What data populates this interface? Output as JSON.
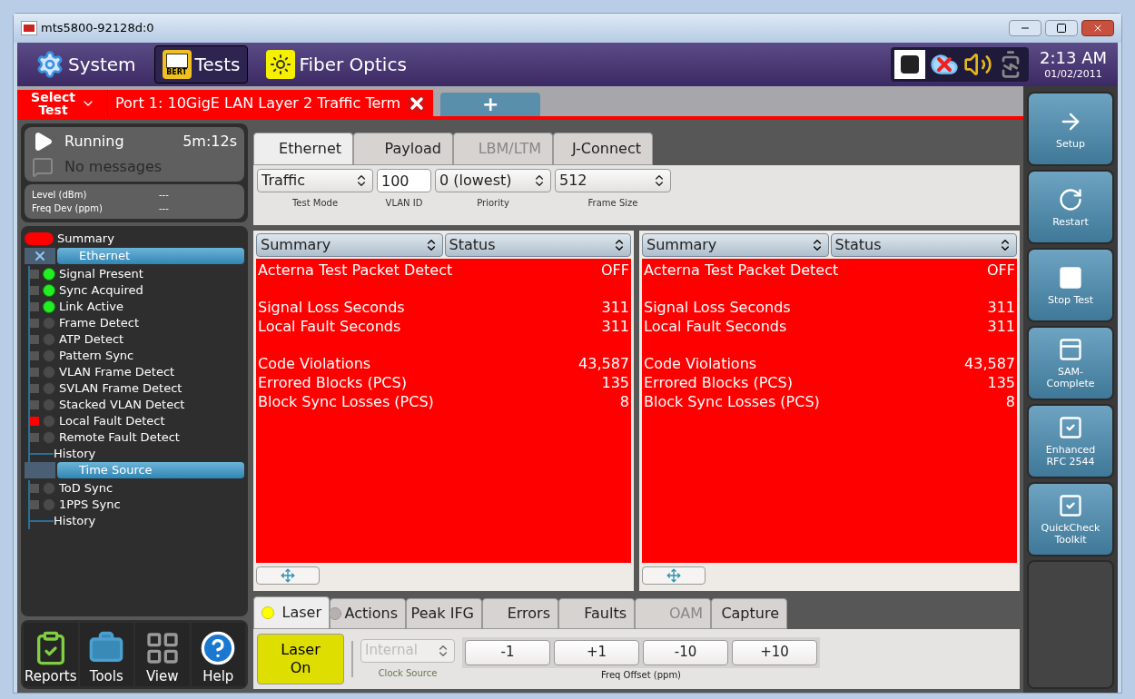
{
  "window": {
    "title": "mts5800-92128d:0"
  },
  "topbar": {
    "menus": [
      {
        "kind": "system",
        "label": "System",
        "selected": false
      },
      {
        "kind": "tests",
        "label": "Tests",
        "badge": "BERT",
        "selected": true
      },
      {
        "kind": "fiber",
        "label": "Fiber Optics",
        "selected": false
      }
    ],
    "time": "2:13 AM",
    "date": "01/02/2011"
  },
  "test_tabs": {
    "select_label": "Select Test",
    "port_tab": "Port 1: 10GigE LAN Layer 2 Traffic Term",
    "add_label": "+"
  },
  "status": {
    "state": "Running",
    "elapsed": "5m:12s",
    "messages": "No messages"
  },
  "readings": [
    {
      "label": "Level (dBm)",
      "value": "---"
    },
    {
      "label": "Freq Dev (ppm)",
      "value": "---"
    }
  ],
  "tree": {
    "summary": "Summary",
    "summary_alarm": true,
    "groups": [
      {
        "title": "Ethernet",
        "closable": true,
        "items": [
          {
            "label": "Signal Present",
            "lit": true,
            "alarm": false
          },
          {
            "label": "Sync Acquired",
            "lit": true,
            "alarm": false
          },
          {
            "label": "Link Active",
            "lit": true,
            "alarm": false
          },
          {
            "label": "Frame Detect",
            "lit": false,
            "alarm": false
          },
          {
            "label": "ATP Detect",
            "lit": false,
            "alarm": false
          },
          {
            "label": "Pattern Sync",
            "lit": false,
            "alarm": false
          },
          {
            "label": "VLAN Frame Detect",
            "lit": false,
            "alarm": false
          },
          {
            "label": "SVLAN Frame Detect",
            "lit": false,
            "alarm": false
          },
          {
            "label": "Stacked VLAN Detect",
            "lit": false,
            "alarm": false
          },
          {
            "label": "Local Fault Detect",
            "lit": false,
            "alarm": true
          },
          {
            "label": "Remote Fault Detect",
            "lit": false,
            "alarm": false
          }
        ],
        "history": "History"
      },
      {
        "title": "Time Source",
        "closable": false,
        "items": [
          {
            "label": "ToD Sync",
            "lit": false,
            "alarm": false
          },
          {
            "label": "1PPS Sync",
            "lit": false,
            "alarm": false
          }
        ],
        "history": "History"
      }
    ]
  },
  "tools": [
    {
      "kind": "reports",
      "label": "Reports"
    },
    {
      "kind": "tools",
      "label": "Tools"
    },
    {
      "kind": "view",
      "label": "View"
    },
    {
      "kind": "help",
      "label": "Help"
    }
  ],
  "config_tabs": [
    {
      "label": "Ethernet",
      "selected": true,
      "disabled": false
    },
    {
      "label": "Payload",
      "selected": false,
      "disabled": false
    },
    {
      "label": "LBM/LTM",
      "selected": false,
      "disabled": true
    },
    {
      "label": "J-Connect",
      "selected": false,
      "disabled": false
    }
  ],
  "config_fields": [
    {
      "kind": "select",
      "value": "Traffic",
      "label": "Test Mode"
    },
    {
      "kind": "input",
      "value": "100",
      "label": "VLAN ID"
    },
    {
      "kind": "select",
      "value": "0 (lowest)",
      "label": "Priority"
    },
    {
      "kind": "select",
      "value": "512",
      "label": "Frame Size"
    }
  ],
  "panes": [
    {
      "columns": [
        "Summary",
        "Status"
      ],
      "groups": [
        [
          {
            "label": "Acterna Test Packet Detect",
            "value": "OFF"
          }
        ],
        [
          {
            "label": "Signal Loss Seconds",
            "value": "311"
          },
          {
            "label": "Local Fault Seconds",
            "value": "311"
          }
        ],
        [
          {
            "label": "Code Violations",
            "value": "43,587"
          },
          {
            "label": "Errored Blocks (PCS)",
            "value": "135"
          },
          {
            "label": "Block Sync Losses (PCS)",
            "value": "8"
          }
        ]
      ]
    },
    {
      "columns": [
        "Summary",
        "Status"
      ],
      "groups": [
        [
          {
            "label": "Acterna Test Packet Detect",
            "value": "OFF"
          }
        ],
        [
          {
            "label": "Signal Loss Seconds",
            "value": "311"
          },
          {
            "label": "Local Fault Seconds",
            "value": "311"
          }
        ],
        [
          {
            "label": "Code Violations",
            "value": "43,587"
          },
          {
            "label": "Errored Blocks (PCS)",
            "value": "135"
          },
          {
            "label": "Block Sync Losses (PCS)",
            "value": "8"
          }
        ]
      ]
    }
  ],
  "action_tabs": [
    {
      "label": "Laser",
      "selected": true,
      "disabled": false,
      "led_lit": true
    },
    {
      "label": "Actions",
      "selected": false,
      "disabled": false,
      "led_lit": false
    },
    {
      "label": "Peak IFG",
      "selected": false,
      "disabled": false
    },
    {
      "label": "Errors",
      "selected": false,
      "disabled": false
    },
    {
      "label": "Faults",
      "selected": false,
      "disabled": false
    },
    {
      "label": "OAM",
      "selected": false,
      "disabled": true
    },
    {
      "label": "Capture",
      "selected": false,
      "disabled": false
    }
  ],
  "laser_button": {
    "label": "Laser On",
    "on": true
  },
  "clock_source": {
    "value": "Internal",
    "label": "Clock Source",
    "disabled": true
  },
  "freq_offset": {
    "buttons": [
      "-1",
      "+1",
      "-10",
      "+10"
    ],
    "label": "Freq Offset (ppm)"
  },
  "side_buttons": [
    {
      "kind": "setup",
      "label": "Setup"
    },
    {
      "kind": "restart",
      "label": "Restart"
    },
    {
      "kind": "stop",
      "label": "Stop Test"
    },
    {
      "kind": "sam",
      "label": "SAM-Complete"
    },
    {
      "kind": "rfc",
      "label": "Enhanced RFC 2544"
    },
    {
      "kind": "quickcheck",
      "label": "QuickCheck Toolkit"
    },
    {
      "kind": "empty"
    }
  ]
}
